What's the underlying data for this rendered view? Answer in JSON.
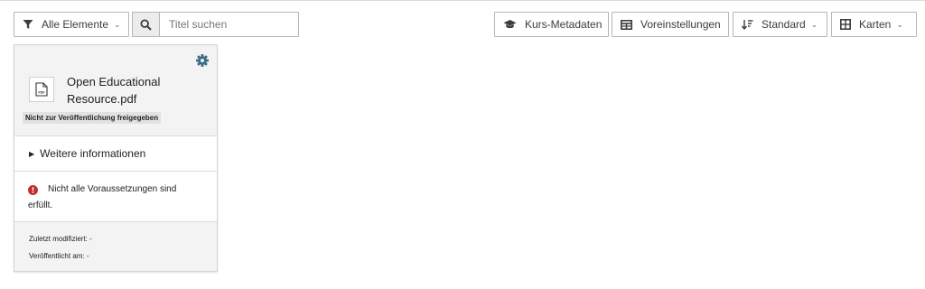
{
  "toolbar": {
    "filter_label": "Alle Elemente",
    "search_placeholder": "Titel suchen",
    "course_metadata_label": "Kurs-Metadaten",
    "presets_label": "Voreinstellungen",
    "sort_label": "Standard",
    "view_label": "Karten"
  },
  "card": {
    "title": "Open Educational Resource.pdf",
    "file_type": "PDF",
    "badge": "Nicht zur Veröffentlichung freigegeben",
    "more_info": "Weitere informationen",
    "prerequisites": "Nicht alle Voraussetzungen sind erfüllt.",
    "last_modified": "Zuletzt modifiziert: -",
    "published": "Veröffentlicht am: -"
  },
  "colors": {
    "border": "#b6b6b6",
    "icon_dark": "#3c3c3c",
    "gear": "#3a6e84",
    "alert": "#c0302f",
    "card_header_bg": "#f3f3f3"
  }
}
